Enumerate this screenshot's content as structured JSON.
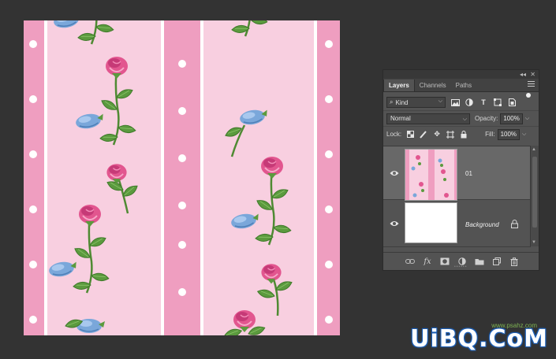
{
  "panel": {
    "tabs": [
      "Layers",
      "Channels",
      "Paths"
    ],
    "active_tab": "Layers",
    "filter": {
      "kind_label": "Kind"
    },
    "blend_mode": "Normal",
    "opacity_label": "Opacity:",
    "opacity_value": "100%",
    "lock_label": "Lock:",
    "fill_label": "Fill:",
    "fill_value": "100%",
    "layers": [
      {
        "name": "01",
        "visible": true,
        "selected": true,
        "locked": false
      },
      {
        "name": "Background",
        "visible": true,
        "selected": false,
        "locked": true
      }
    ]
  },
  "watermark": {
    "text": "UiBQ.CoM",
    "sub": "www.psahz.com"
  },
  "colors": {
    "app_bg": "#333333",
    "panel_bg": "#535353",
    "selected_layer": "#686868",
    "stripe_pink": "#ef9ec0",
    "light_pink": "#f8cfe0",
    "rose": "#e2568f",
    "leaf": "#5b9a3e",
    "blue_flower": "#7aa7da"
  },
  "icons": {
    "visibility": "eye-icon",
    "lock": "lock-icon",
    "link": "link-icon",
    "fx": "fx-icon",
    "mask": "mask-icon",
    "adjustment": "adjustment-icon",
    "group": "folder-icon",
    "new_layer": "new-layer-icon",
    "delete": "trash-icon"
  }
}
